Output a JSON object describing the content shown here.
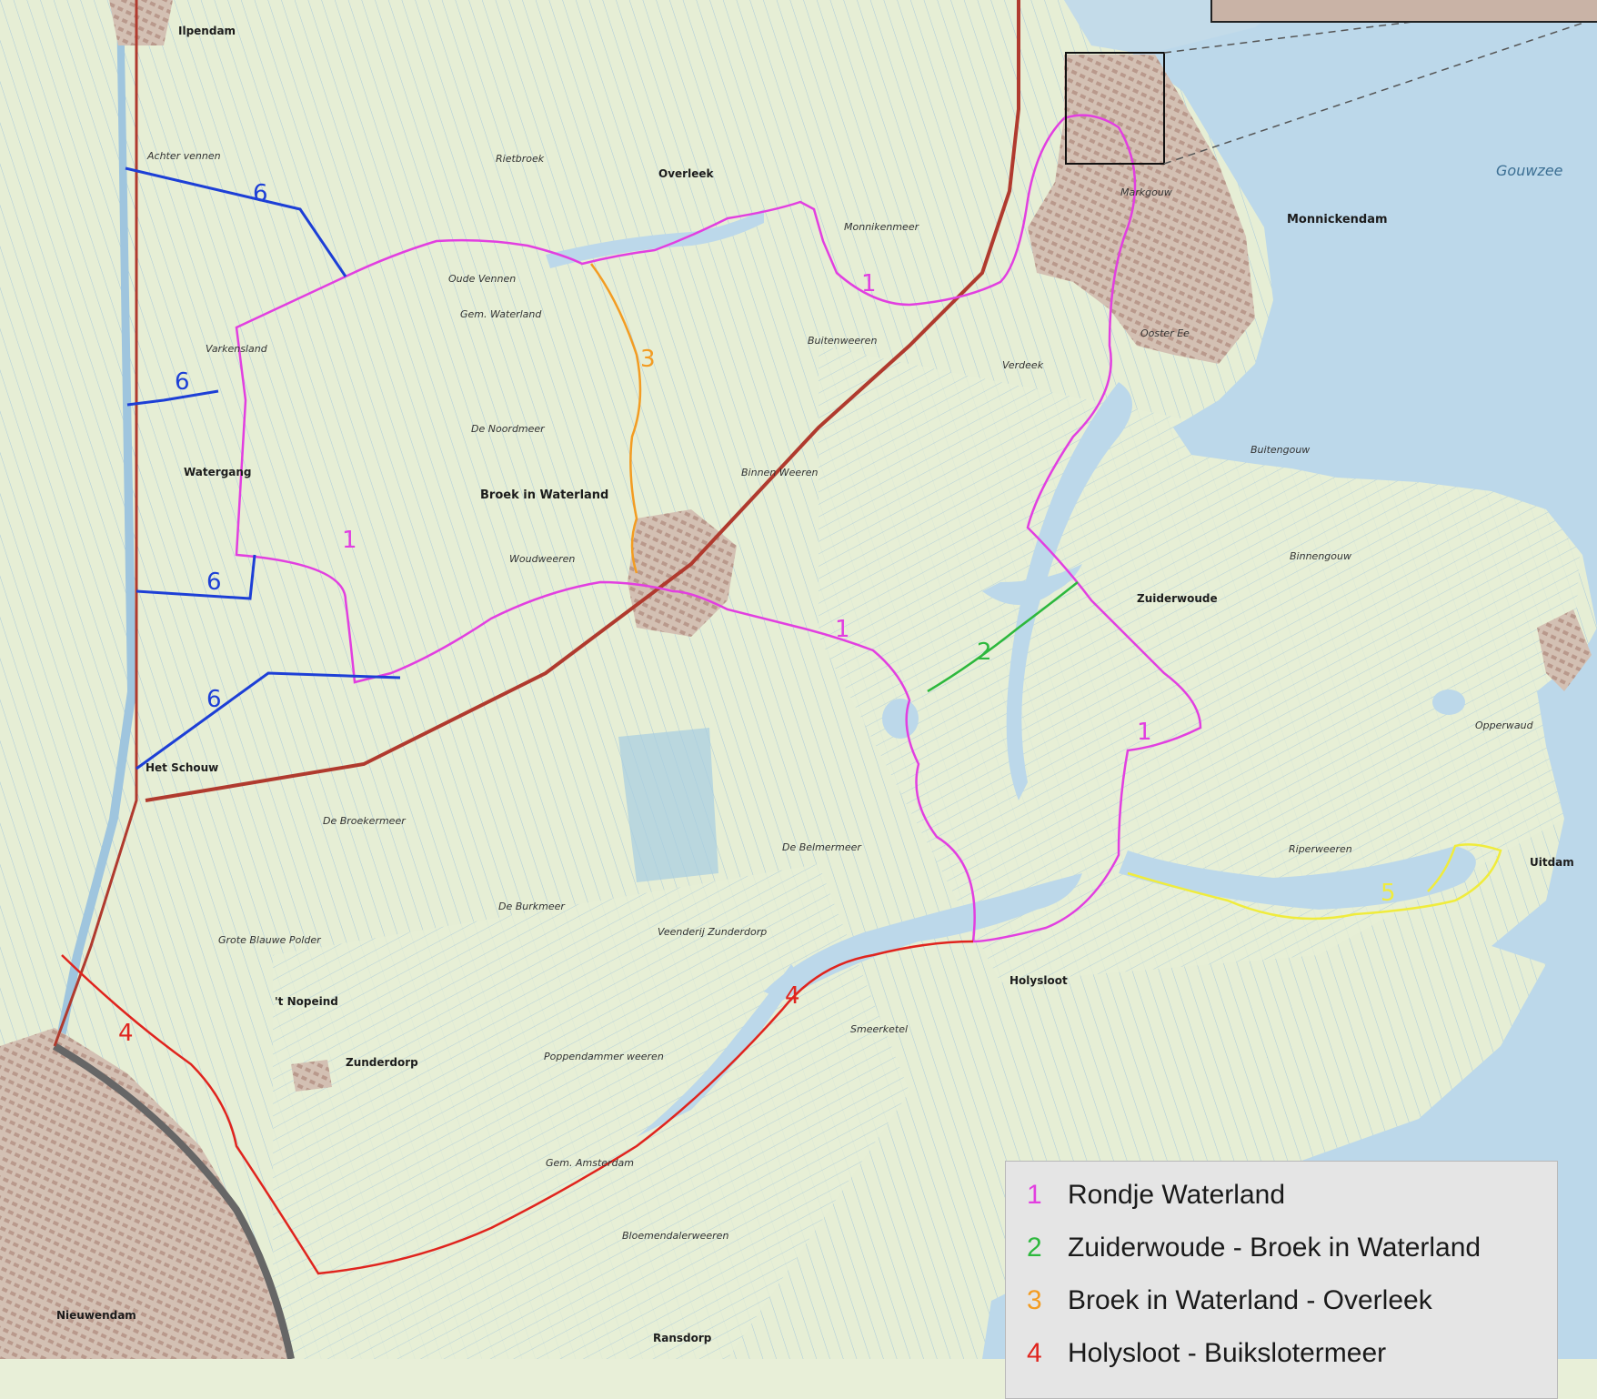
{
  "map": {
    "places": [
      {
        "id": "ilpendam",
        "name": "Ilpendam"
      },
      {
        "id": "overleek",
        "name": "Overleek"
      },
      {
        "id": "monnickendam",
        "name": "Monnickendam"
      },
      {
        "id": "broek-in-waterland",
        "name": "Broek in Waterland"
      },
      {
        "id": "watergang",
        "name": "Watergang"
      },
      {
        "id": "zuiderwoude",
        "name": "Zuiderwoude"
      },
      {
        "id": "het-schouw",
        "name": "Het Schouw"
      },
      {
        "id": "holysloot",
        "name": "Holysloot"
      },
      {
        "id": "uitdam",
        "name": "Uitdam"
      },
      {
        "id": "zunderdorp",
        "name": "Zunderdorp"
      },
      {
        "id": "t-nopeind",
        "name": "'t Nopeind"
      },
      {
        "id": "ransdorp",
        "name": "Ransdorp"
      },
      {
        "id": "nieuwendam",
        "name": "Nieuwendam"
      },
      {
        "id": "marken-gouw",
        "name": "Markgouw"
      },
      {
        "id": "ooster-ee",
        "name": "Ooster Ee"
      }
    ],
    "polders": [
      {
        "id": "achter-vennen",
        "name": "Achter vennen"
      },
      {
        "id": "rietbroek",
        "name": "Rietbroek"
      },
      {
        "id": "monnikenmeer",
        "name": "Monnikenmeer"
      },
      {
        "id": "oude-vennen",
        "name": "Oude Vennen"
      },
      {
        "id": "gem-waterland",
        "name": "Gem. Waterland"
      },
      {
        "id": "varkensland",
        "name": "Varkensland"
      },
      {
        "id": "buitenweeren",
        "name": "Buitenweeren"
      },
      {
        "id": "verdeek",
        "name": "Verdeek"
      },
      {
        "id": "de-noordmeer",
        "name": "De Noordmeer"
      },
      {
        "id": "binnen-weeren",
        "name": "Binnen Weeren"
      },
      {
        "id": "woudweeren",
        "name": "Woudweeren"
      },
      {
        "id": "buitengouw",
        "name": "Buitengouw"
      },
      {
        "id": "binnengouw",
        "name": "Binnengouw"
      },
      {
        "id": "de-broekermeer",
        "name": "De Broekermeer"
      },
      {
        "id": "de-belmermeer",
        "name": "De Belmermeer"
      },
      {
        "id": "riperweeren",
        "name": "Riperweeren"
      },
      {
        "id": "de-burkmeer",
        "name": "De Burkmeer"
      },
      {
        "id": "grote-blauwe-polder",
        "name": "Grote Blauwe Polder"
      },
      {
        "id": "poppendammer-weeren",
        "name": "Poppendammer weeren"
      },
      {
        "id": "gem-amsterdam",
        "name": "Gem. Amsterdam"
      },
      {
        "id": "smeerketel",
        "name": "Smeerketel"
      },
      {
        "id": "opperwaud",
        "name": "Opperwaud"
      },
      {
        "id": "bloemendalerweeren",
        "name": "Bloemendalerweeren"
      },
      {
        "id": "veenderij-zunderdorp",
        "name": "Veenderij Zunderdorp"
      }
    ],
    "water": [
      {
        "id": "gouwzee",
        "name": "Gouwzee"
      }
    ],
    "route_labels": [
      {
        "id": "r1a",
        "num": "1",
        "color": "#e23fe0"
      },
      {
        "id": "r1b",
        "num": "1",
        "color": "#e23fe0"
      },
      {
        "id": "r1c",
        "num": "1",
        "color": "#e23fe0"
      },
      {
        "id": "r1d",
        "num": "1",
        "color": "#e23fe0"
      },
      {
        "id": "r2",
        "num": "2",
        "color": "#2db83d"
      },
      {
        "id": "r3",
        "num": "3",
        "color": "#f39c22"
      },
      {
        "id": "r4a",
        "num": "4",
        "color": "#e0241e"
      },
      {
        "id": "r4b",
        "num": "4",
        "color": "#e0241e"
      },
      {
        "id": "r5",
        "num": "5",
        "color": "#f0ec3c"
      },
      {
        "id": "r6a",
        "num": "6",
        "color": "#1d3fd6"
      },
      {
        "id": "r6b",
        "num": "6",
        "color": "#1d3fd6"
      },
      {
        "id": "r6c",
        "num": "6",
        "color": "#1d3fd6"
      },
      {
        "id": "r6d",
        "num": "6",
        "color": "#1d3fd6"
      }
    ]
  },
  "legend": {
    "items": [
      {
        "num": "1",
        "label": "Rondje Waterland",
        "color": "#e23fe0"
      },
      {
        "num": "2",
        "label": "Zuiderwoude - Broek in Waterland",
        "color": "#2db83d"
      },
      {
        "num": "3",
        "label": "Broek in Waterland - Overleek",
        "color": "#f39c22"
      },
      {
        "num": "4",
        "label": "Holysloot - Buikslotermeer",
        "color": "#e0241e"
      }
    ]
  },
  "colors": {
    "land": "#e8efd8",
    "water": "#bcd8ea",
    "ditch": "#9fc5de",
    "urban": "#c9b3a6",
    "road": "#b03a2e"
  }
}
